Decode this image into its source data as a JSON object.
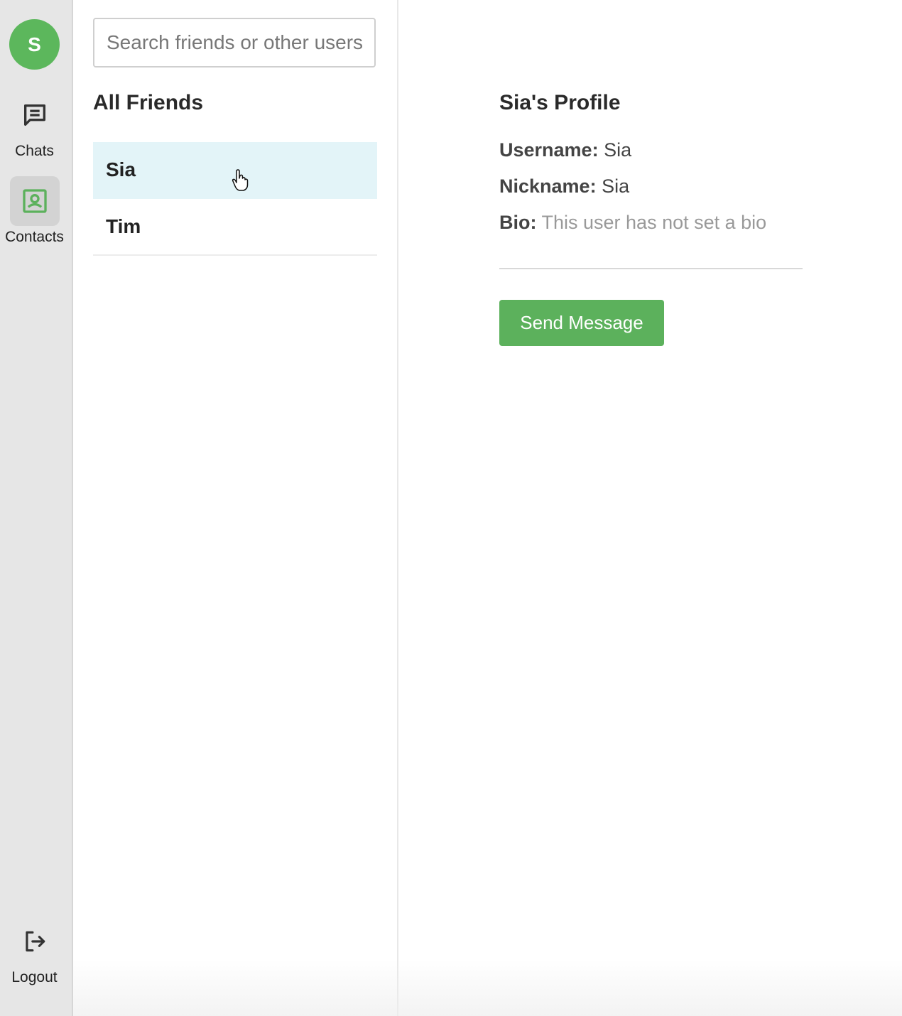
{
  "user": {
    "avatar_initial": "S",
    "avatar_color": "#5cb75c"
  },
  "nav": {
    "chats_label": "Chats",
    "contacts_label": "Contacts",
    "logout_label": "Logout",
    "active": "contacts"
  },
  "search": {
    "placeholder": "Search friends or other users",
    "value": ""
  },
  "friends": {
    "title": "All Friends",
    "items": [
      {
        "name": "Sia",
        "selected": true
      },
      {
        "name": "Tim",
        "selected": false
      }
    ]
  },
  "profile": {
    "title": "Sia's Profile",
    "username_label": "Username:",
    "username_value": "Sia",
    "nickname_label": "Nickname:",
    "nickname_value": "Sia",
    "bio_label": "Bio:",
    "bio_value": "This user has not set a bio",
    "send_button": "Send Message"
  },
  "colors": {
    "accent_green": "#5cb15c",
    "selected_row": "#e3f4f8",
    "rail_bg": "#e6e6e6"
  }
}
